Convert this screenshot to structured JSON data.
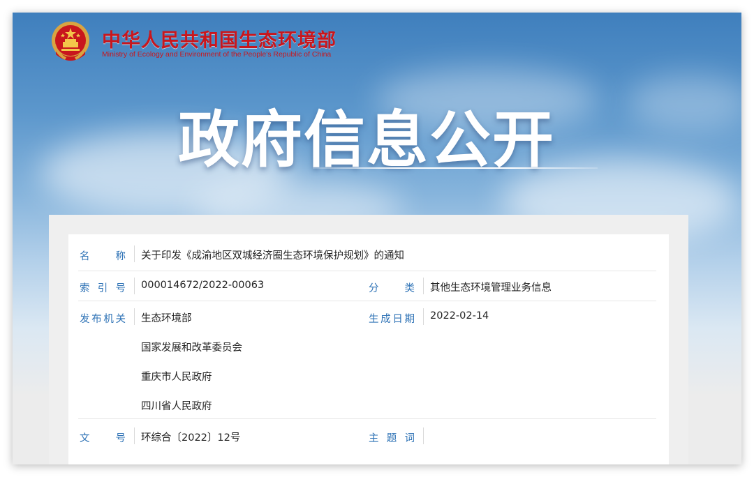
{
  "site": {
    "name_cn": "中华人民共和国生态环境部",
    "name_en": "Ministry of Ecology and Environment of the People's Republic of China",
    "emblem_icon": "national-emblem-icon",
    "brand_color": "#c8161d"
  },
  "banner": {
    "title": "政府信息公开"
  },
  "record": {
    "name": {
      "label": "名　称",
      "value": "关于印发《成渝地区双城经济圈生态环境保护规划》的通知"
    },
    "index_no": {
      "label": "索引号",
      "value": "000014672/2022-00063"
    },
    "category": {
      "label": "分　类",
      "value": "其他生态环境管理业务信息"
    },
    "issuers": {
      "label": "发布机关",
      "values": [
        "生态环境部",
        "国家发展和改革委员会",
        "重庆市人民政府",
        "四川省人民政府"
      ]
    },
    "date": {
      "label": "生成日期",
      "value": "2022-02-14"
    },
    "doc_no": {
      "label": "文　号",
      "value": "环综合〔2022〕12号"
    },
    "keywords": {
      "label": "主题词",
      "value": ""
    }
  },
  "colors": {
    "label": "#2f73b6",
    "value": "#222222"
  }
}
